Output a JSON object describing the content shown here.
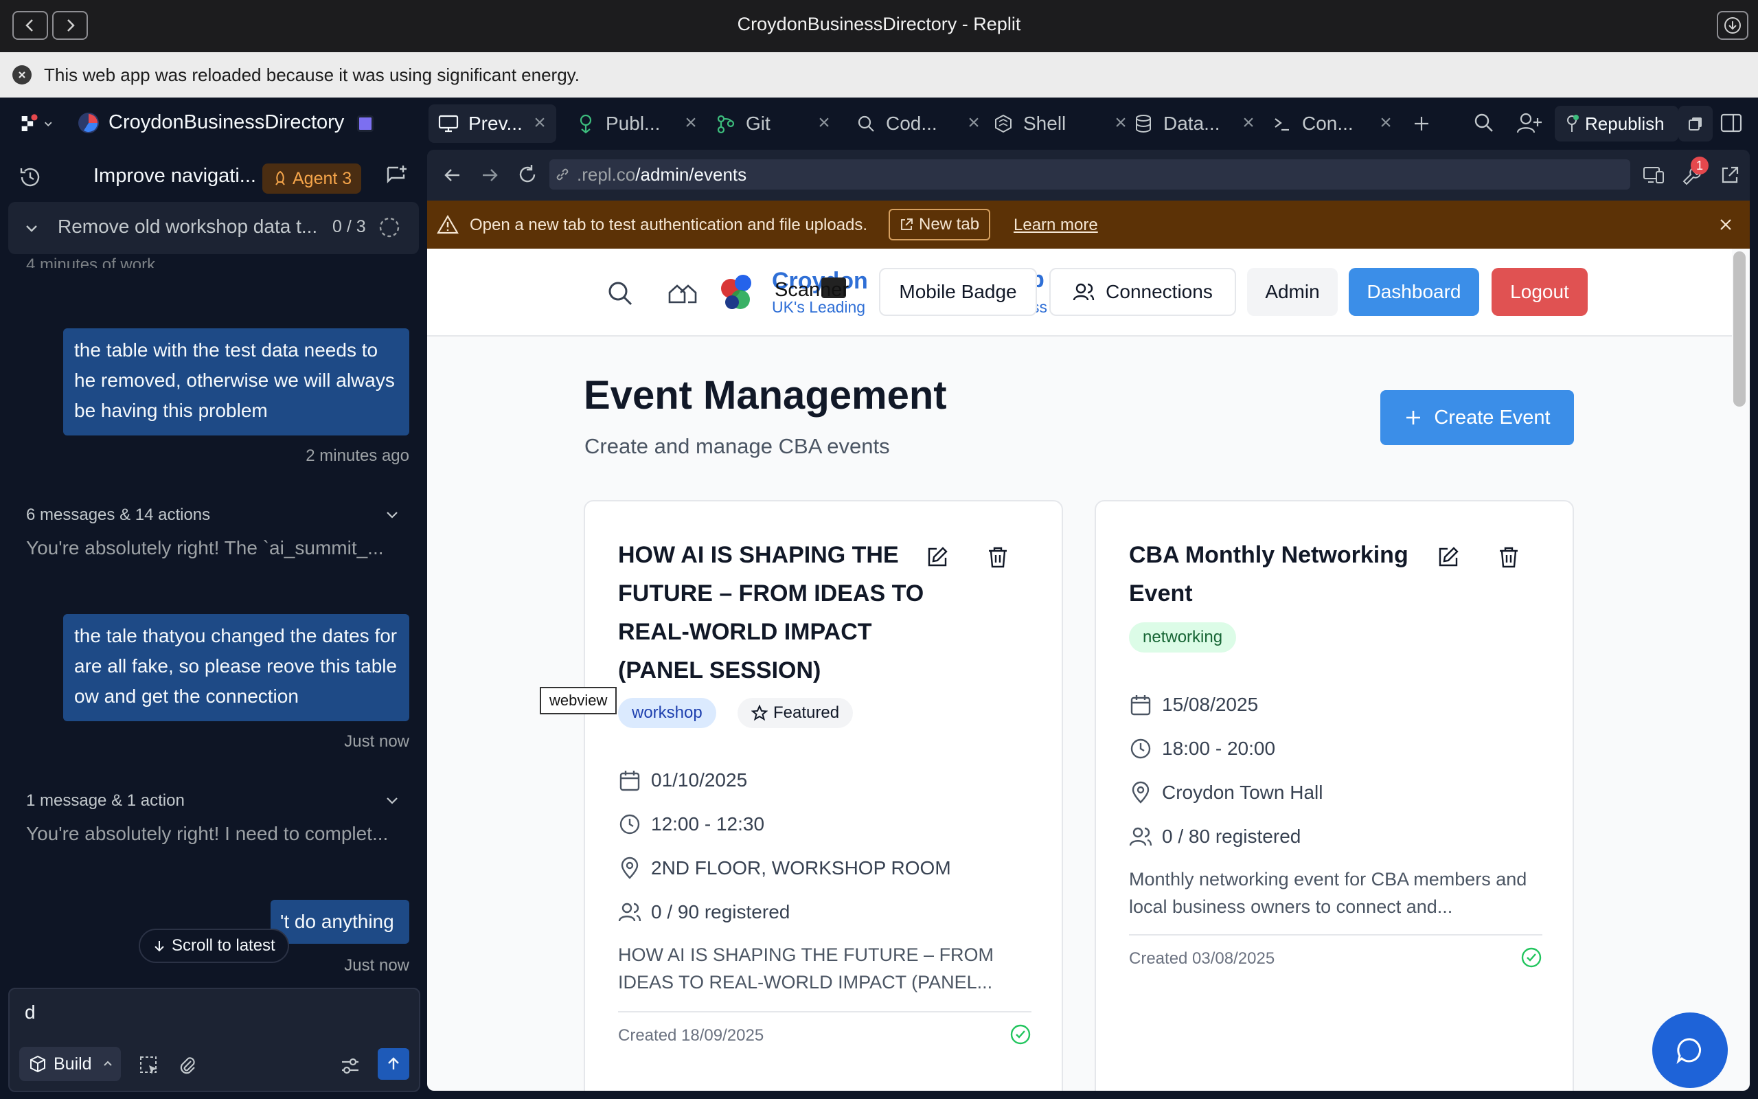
{
  "window": {
    "title": "CroydonBusinessDirectory - Replit",
    "notice": "This web app was reloaded because it was using significant energy."
  },
  "toolbar": {
    "project_name": "CroydonBusinessDirectory",
    "tabs": [
      {
        "label": "Prev...",
        "icon": "monitor-icon"
      },
      {
        "label": "Publ...",
        "icon": "publish-icon"
      },
      {
        "label": "Git",
        "icon": "git-icon"
      },
      {
        "label": "Cod...",
        "icon": "search-icon"
      },
      {
        "label": "Shell",
        "icon": "shell-icon"
      },
      {
        "label": "Data...",
        "icon": "database-icon"
      },
      {
        "label": "Con...",
        "icon": "console-icon"
      }
    ],
    "republish_label": "Republish"
  },
  "agent": {
    "thread_title": "Improve navigati...",
    "agent_badge": "Agent 3",
    "task_title": "Remove old workshop data t...",
    "task_progress": "0 / 3",
    "partial_line": "4 minutes of work",
    "messages": [
      {
        "type": "user",
        "text": "the table with the test data needs to he removed, otherwise we will always be having this problem",
        "time": "2 minutes ago"
      },
      {
        "type": "summary",
        "title": "6 messages & 14 actions",
        "text": "You're absolutely right! The `ai_summit_..."
      },
      {
        "type": "user",
        "text": "the tale thatyou changed the dates for are all fake, so please reove this table ow and get the connection",
        "time": "Just now"
      },
      {
        "type": "summary",
        "title": "1 message & 1 action",
        "text": "You're absolutely right! I need to complet..."
      },
      {
        "type": "user",
        "text": "'t do anything",
        "time": "Just now"
      }
    ],
    "scroll_to_latest": "Scroll to latest",
    "input_value": "d",
    "mode_label": "Build"
  },
  "browser": {
    "url_prefix": ".repl.co",
    "url_path": "/admin/events",
    "warning_text": "Open a new tab to test authentication and file uploads.",
    "new_tab_label": "New tab",
    "learn_more_label": "Learn more",
    "notification_count": "1",
    "webview_tooltip": "webview"
  },
  "site": {
    "logo_title": "Croydon",
    "logo_subtitle": "UK's Leading",
    "logo_subtitle_tail": "ss",
    "logo_tail": "p",
    "nav": {
      "scanner": "Scanner",
      "mobile_badge": "Mobile Badge",
      "connections": "Connections",
      "admin": "Admin",
      "dashboard": "Dashboard",
      "logout": "Logout"
    },
    "page_title": "Event Management",
    "page_subtitle": "Create and manage CBA events",
    "create_event": "Create Event",
    "events": [
      {
        "title": "HOW AI IS SHAPING THE FUTURE – FROM IDEAS TO REAL-WORLD IMPACT (PANEL SESSION)",
        "tag": "workshop",
        "featured": "Featured",
        "date": "01/10/2025",
        "time": "12:00 - 12:30",
        "location": "2ND FLOOR, WORKSHOP ROOM",
        "registered": "0 / 90 registered",
        "description": "HOW AI IS SHAPING THE FUTURE – FROM IDEAS TO REAL-WORLD IMPACT (PANEL...",
        "created": "Created 18/09/2025"
      },
      {
        "title": "CBA Monthly Networking Event",
        "tag": "networking",
        "date": "15/08/2025",
        "time": "18:00 - 20:00",
        "location": "Croydon Town Hall",
        "registered": "0 / 80 registered",
        "description": "Monthly networking event for CBA members and local business owners to connect and...",
        "created": "Created 03/08/2025"
      }
    ]
  },
  "colors": {
    "replit_bg": "#0e1525",
    "user_bubble": "#1e4a86",
    "primary_blue": "#3b8ee8",
    "logout_red": "#e05252",
    "warning_bg": "#5c3206"
  }
}
